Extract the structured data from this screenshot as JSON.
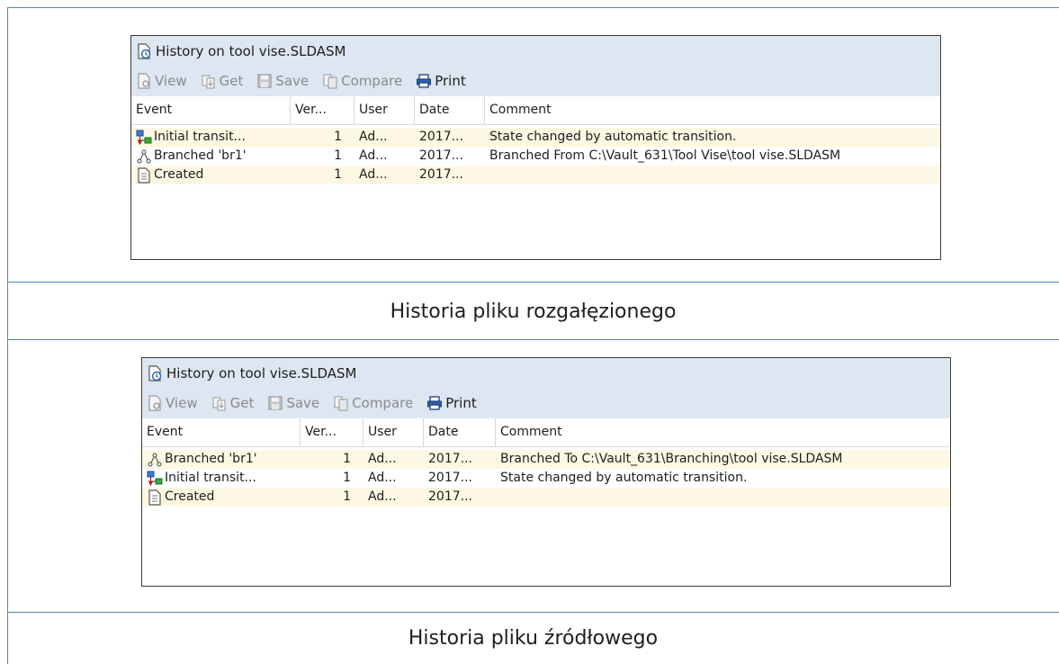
{
  "panels": [
    {
      "title": "History on tool vise.SLDASM",
      "toolbar": {
        "view": "View",
        "get": "Get",
        "save": "Save",
        "compare": "Compare",
        "print": "Print"
      },
      "columns": {
        "event": "Event",
        "version": "Ver...",
        "user": "User",
        "date": "Date",
        "comment": "Comment"
      },
      "rows": [
        {
          "icon": "transition-icon",
          "event": "Initial transit...",
          "version": "1",
          "user": "Ad...",
          "date": "2017...",
          "comment": "State changed by automatic transition."
        },
        {
          "icon": "branch-icon",
          "event": "Branched 'br1'",
          "version": "1",
          "user": "Ad...",
          "date": "2017...",
          "comment": "Branched From C:\\Vault_631\\Tool Vise\\tool vise.SLDASM"
        },
        {
          "icon": "document-icon",
          "event": "Created",
          "version": "1",
          "user": "Ad...",
          "date": "2017...",
          "comment": ""
        }
      ]
    },
    {
      "title": "History on tool vise.SLDASM",
      "toolbar": {
        "view": "View",
        "get": "Get",
        "save": "Save",
        "compare": "Compare",
        "print": "Print"
      },
      "columns": {
        "event": "Event",
        "version": "Ver...",
        "user": "User",
        "date": "Date",
        "comment": "Comment"
      },
      "rows": [
        {
          "icon": "branch-icon",
          "event": "Branched 'br1'",
          "version": "1",
          "user": "Ad...",
          "date": "2017...",
          "comment": "Branched To C:\\Vault_631\\Branching\\tool vise.SLDASM"
        },
        {
          "icon": "transition-icon",
          "event": "Initial transit...",
          "version": "1",
          "user": "Ad...",
          "date": "2017...",
          "comment": "State changed by automatic transition."
        },
        {
          "icon": "document-icon",
          "event": "Created",
          "version": "1",
          "user": "Ad...",
          "date": "2017...",
          "comment": ""
        }
      ]
    }
  ],
  "captions": {
    "first": "Historia pliku rozgałęzionego",
    "second": "Historia pliku źródłowego"
  },
  "colors": {
    "accent_line": "#4f81bd",
    "header_bg": "#dde6f1",
    "row_alt": "#fdf8e3"
  }
}
